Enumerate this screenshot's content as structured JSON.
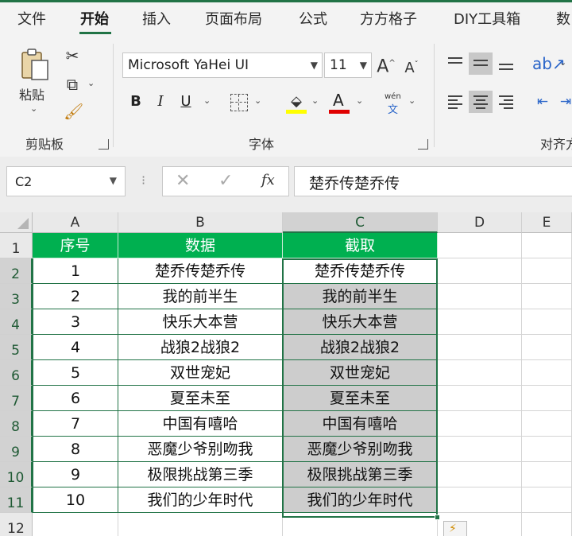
{
  "ribbon": {
    "tabs": [
      {
        "label": "文件",
        "active": false
      },
      {
        "label": "开始",
        "active": true
      },
      {
        "label": "插入",
        "active": false
      },
      {
        "label": "页面布局",
        "active": false
      },
      {
        "label": "公式",
        "active": false
      },
      {
        "label": "方方格子",
        "active": false
      },
      {
        "label": "DIY工具箱",
        "active": false
      },
      {
        "label": "数",
        "active": false
      }
    ],
    "clipboard": {
      "paste_label": "粘贴",
      "group_label": "剪贴板"
    },
    "font": {
      "family": "Microsoft YaHei UI",
      "size": "11",
      "bold_label": "B",
      "italic_label": "I",
      "underline_label": "U",
      "font_color_label": "A",
      "phonetic_top": "wén",
      "phonetic_bottom": "文",
      "group_label": "字体"
    },
    "alignment": {
      "group_label": "对齐方"
    }
  },
  "formula_bar": {
    "name_box": "C2",
    "formula": "楚乔传楚乔传",
    "fx_label": "fx"
  },
  "sheet": {
    "columns": [
      "A",
      "B",
      "C",
      "D",
      "E"
    ],
    "rows": [
      "1",
      "2",
      "3",
      "4",
      "5",
      "6",
      "7",
      "8",
      "9",
      "10",
      "11",
      "12"
    ],
    "header_row": [
      "序号",
      "数据",
      "截取"
    ],
    "data": [
      [
        "1",
        "楚乔传楚乔传",
        "楚乔传楚乔传"
      ],
      [
        "2",
        "我的前半生",
        "我的前半生"
      ],
      [
        "3",
        "快乐大本营",
        "快乐大本营"
      ],
      [
        "4",
        "战狼2战狼2",
        "战狼2战狼2"
      ],
      [
        "5",
        "双世宠妃",
        "双世宠妃"
      ],
      [
        "6",
        "夏至未至",
        "夏至未至"
      ],
      [
        "7",
        "中国有嘻哈",
        "中国有嘻哈"
      ],
      [
        "8",
        "恶魔少爷别吻我",
        "恶魔少爷别吻我"
      ],
      [
        "9",
        "极限挑战第三季",
        "极限挑战第三季"
      ],
      [
        "10",
        "我们的少年时代",
        "我们的少年时代"
      ]
    ],
    "selected_column": "C",
    "colors": {
      "header_fill": "#00b050",
      "excel_green": "#217346",
      "selection_gray": "#cdcdcd"
    }
  }
}
